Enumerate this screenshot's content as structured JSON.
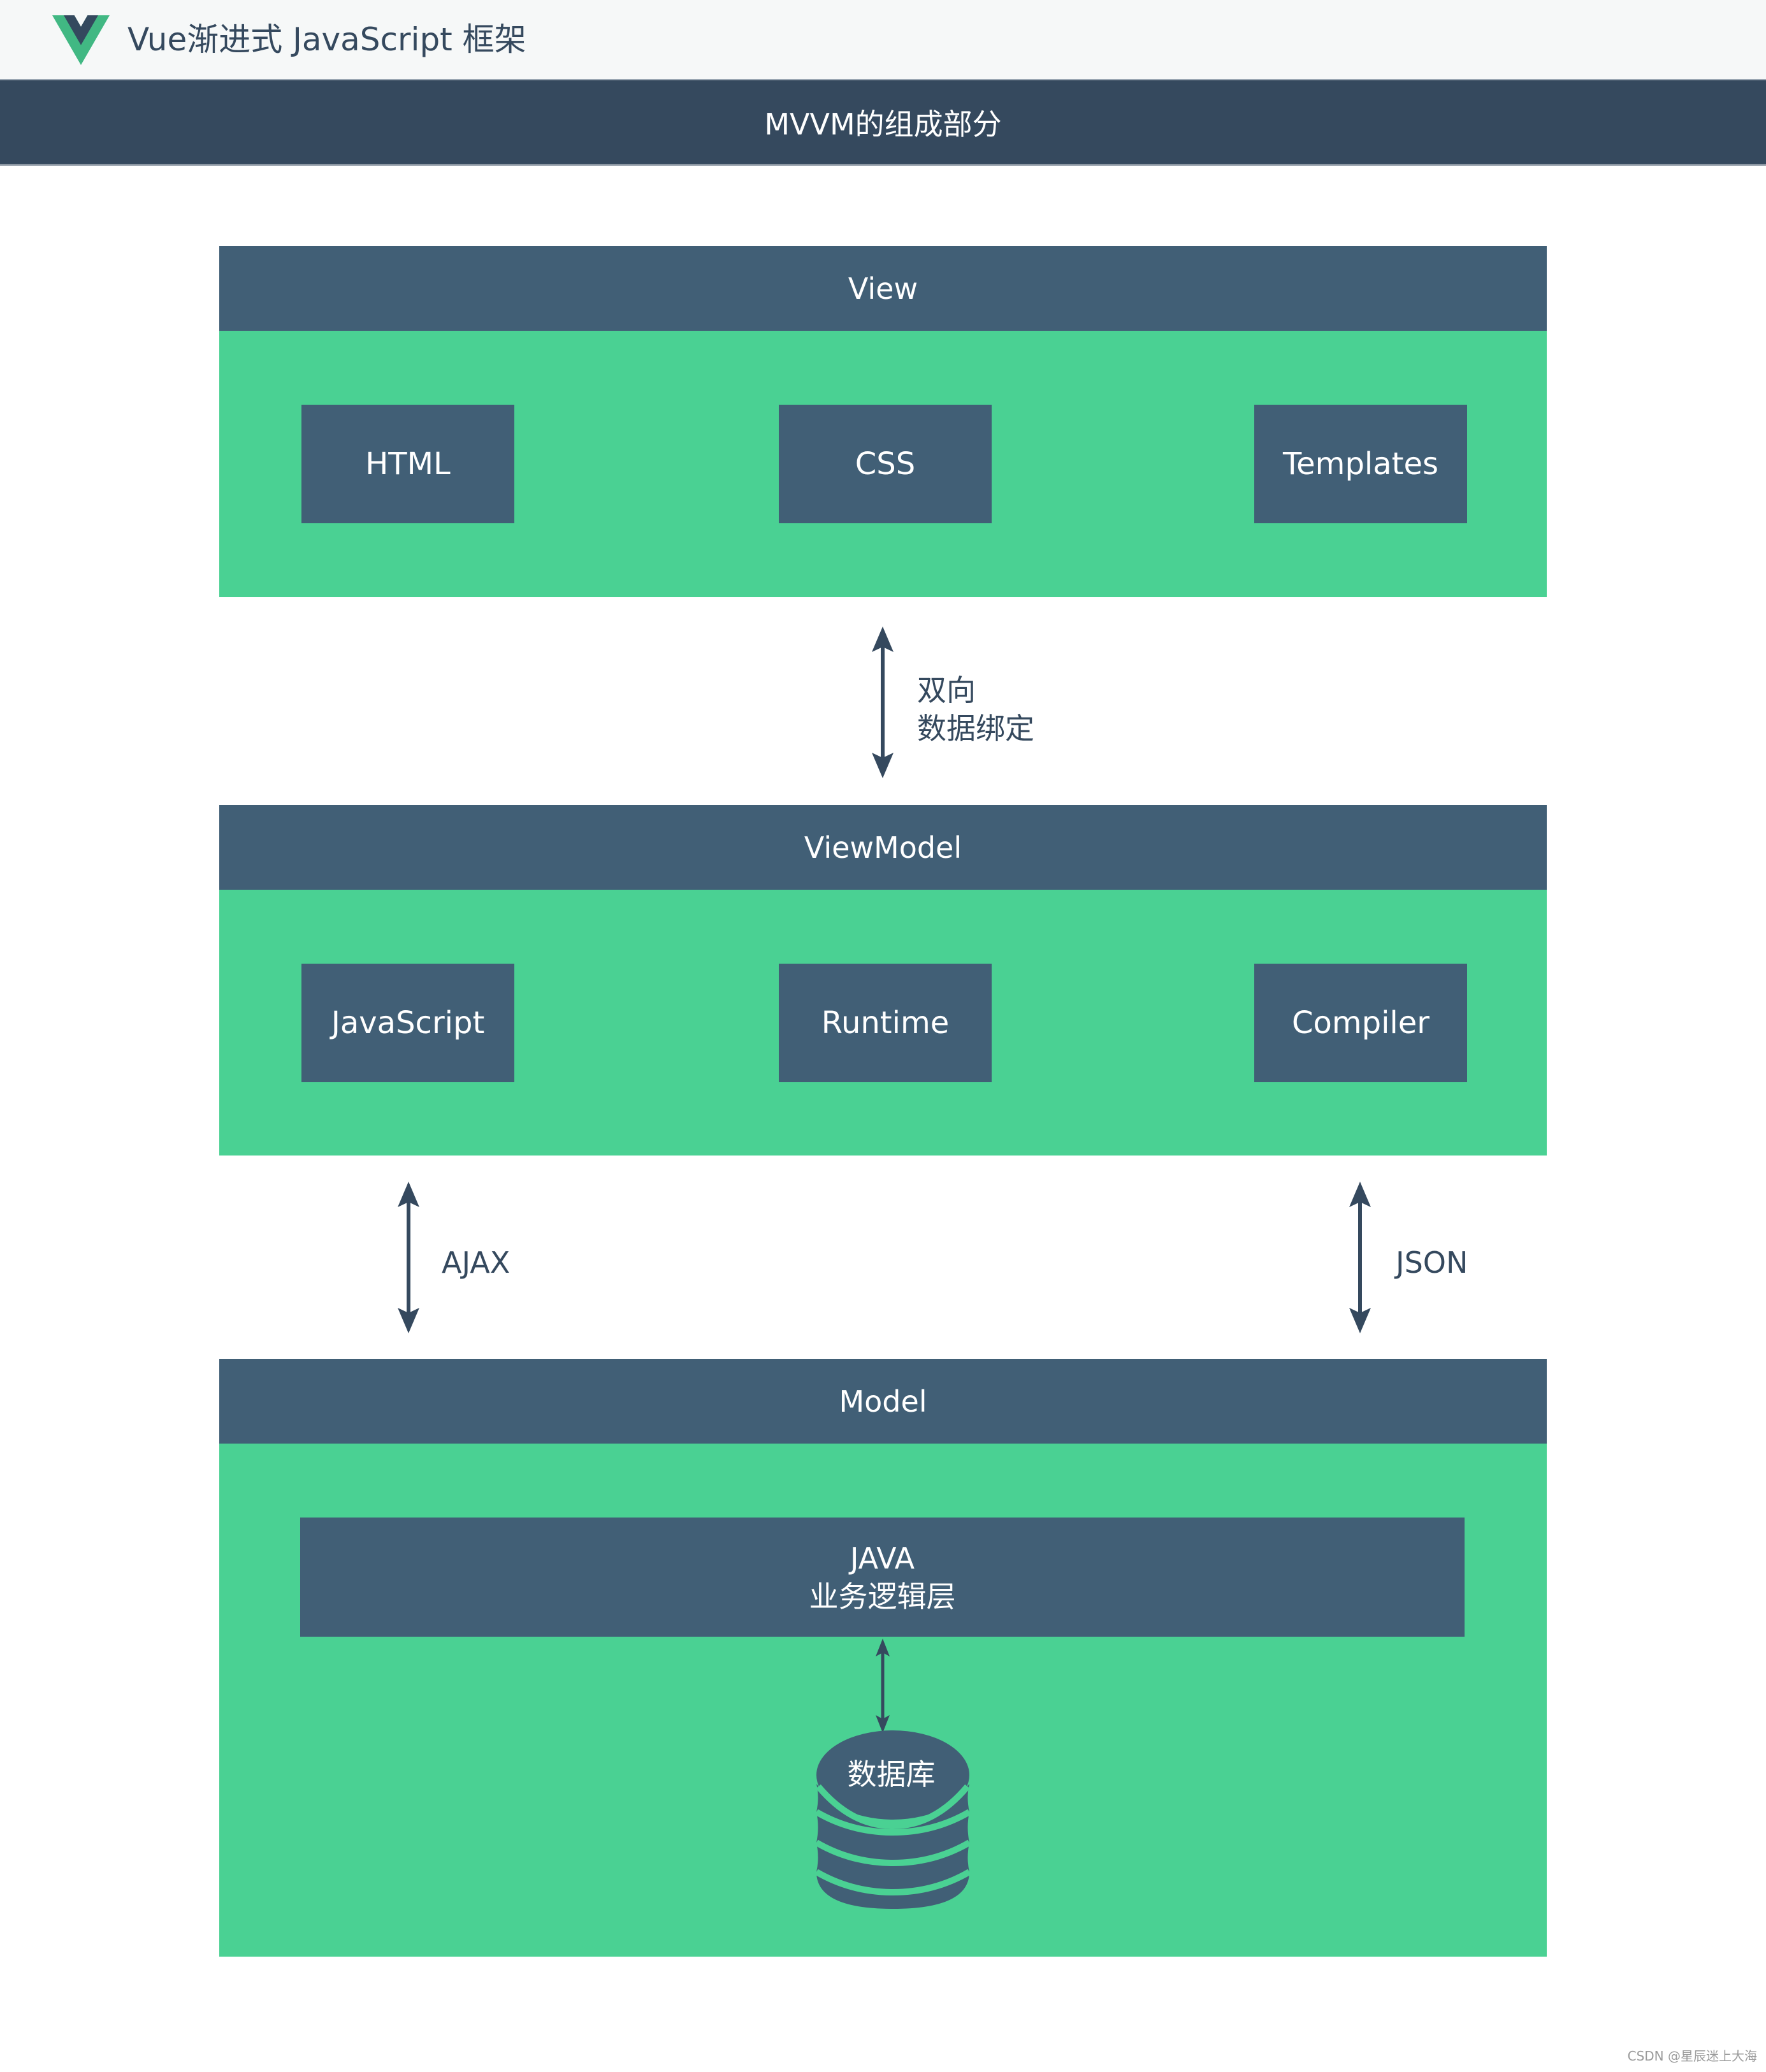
{
  "header": {
    "logo_icon": "vue-logo-icon",
    "brand_text": "Vue渐进式 JavaScript 框架"
  },
  "title_bar": {
    "title": "MVVM的组成部分"
  },
  "colors": {
    "dark": "#35495e",
    "section": "#415f76",
    "green": "#4ad193",
    "vue_green": "#41b883"
  },
  "sections": {
    "view": {
      "title": "View",
      "items": [
        "HTML",
        "CSS",
        "Templates"
      ]
    },
    "viewmodel": {
      "title": "ViewModel",
      "items": [
        "JavaScript",
        "Runtime",
        "Compiler"
      ]
    },
    "model": {
      "title": "Model",
      "logic_layer": {
        "line1": "JAVA",
        "line2": "业务逻辑层"
      },
      "database": {
        "icon": "database-icon",
        "label": "数据库"
      }
    }
  },
  "connectors": {
    "view_viewmodel": {
      "line1": "双向",
      "line2": "数据绑定"
    },
    "viewmodel_model_left": {
      "label": "AJAX"
    },
    "viewmodel_model_right": {
      "label": "JSON"
    }
  },
  "watermark": "CSDN @星辰迷上大海"
}
